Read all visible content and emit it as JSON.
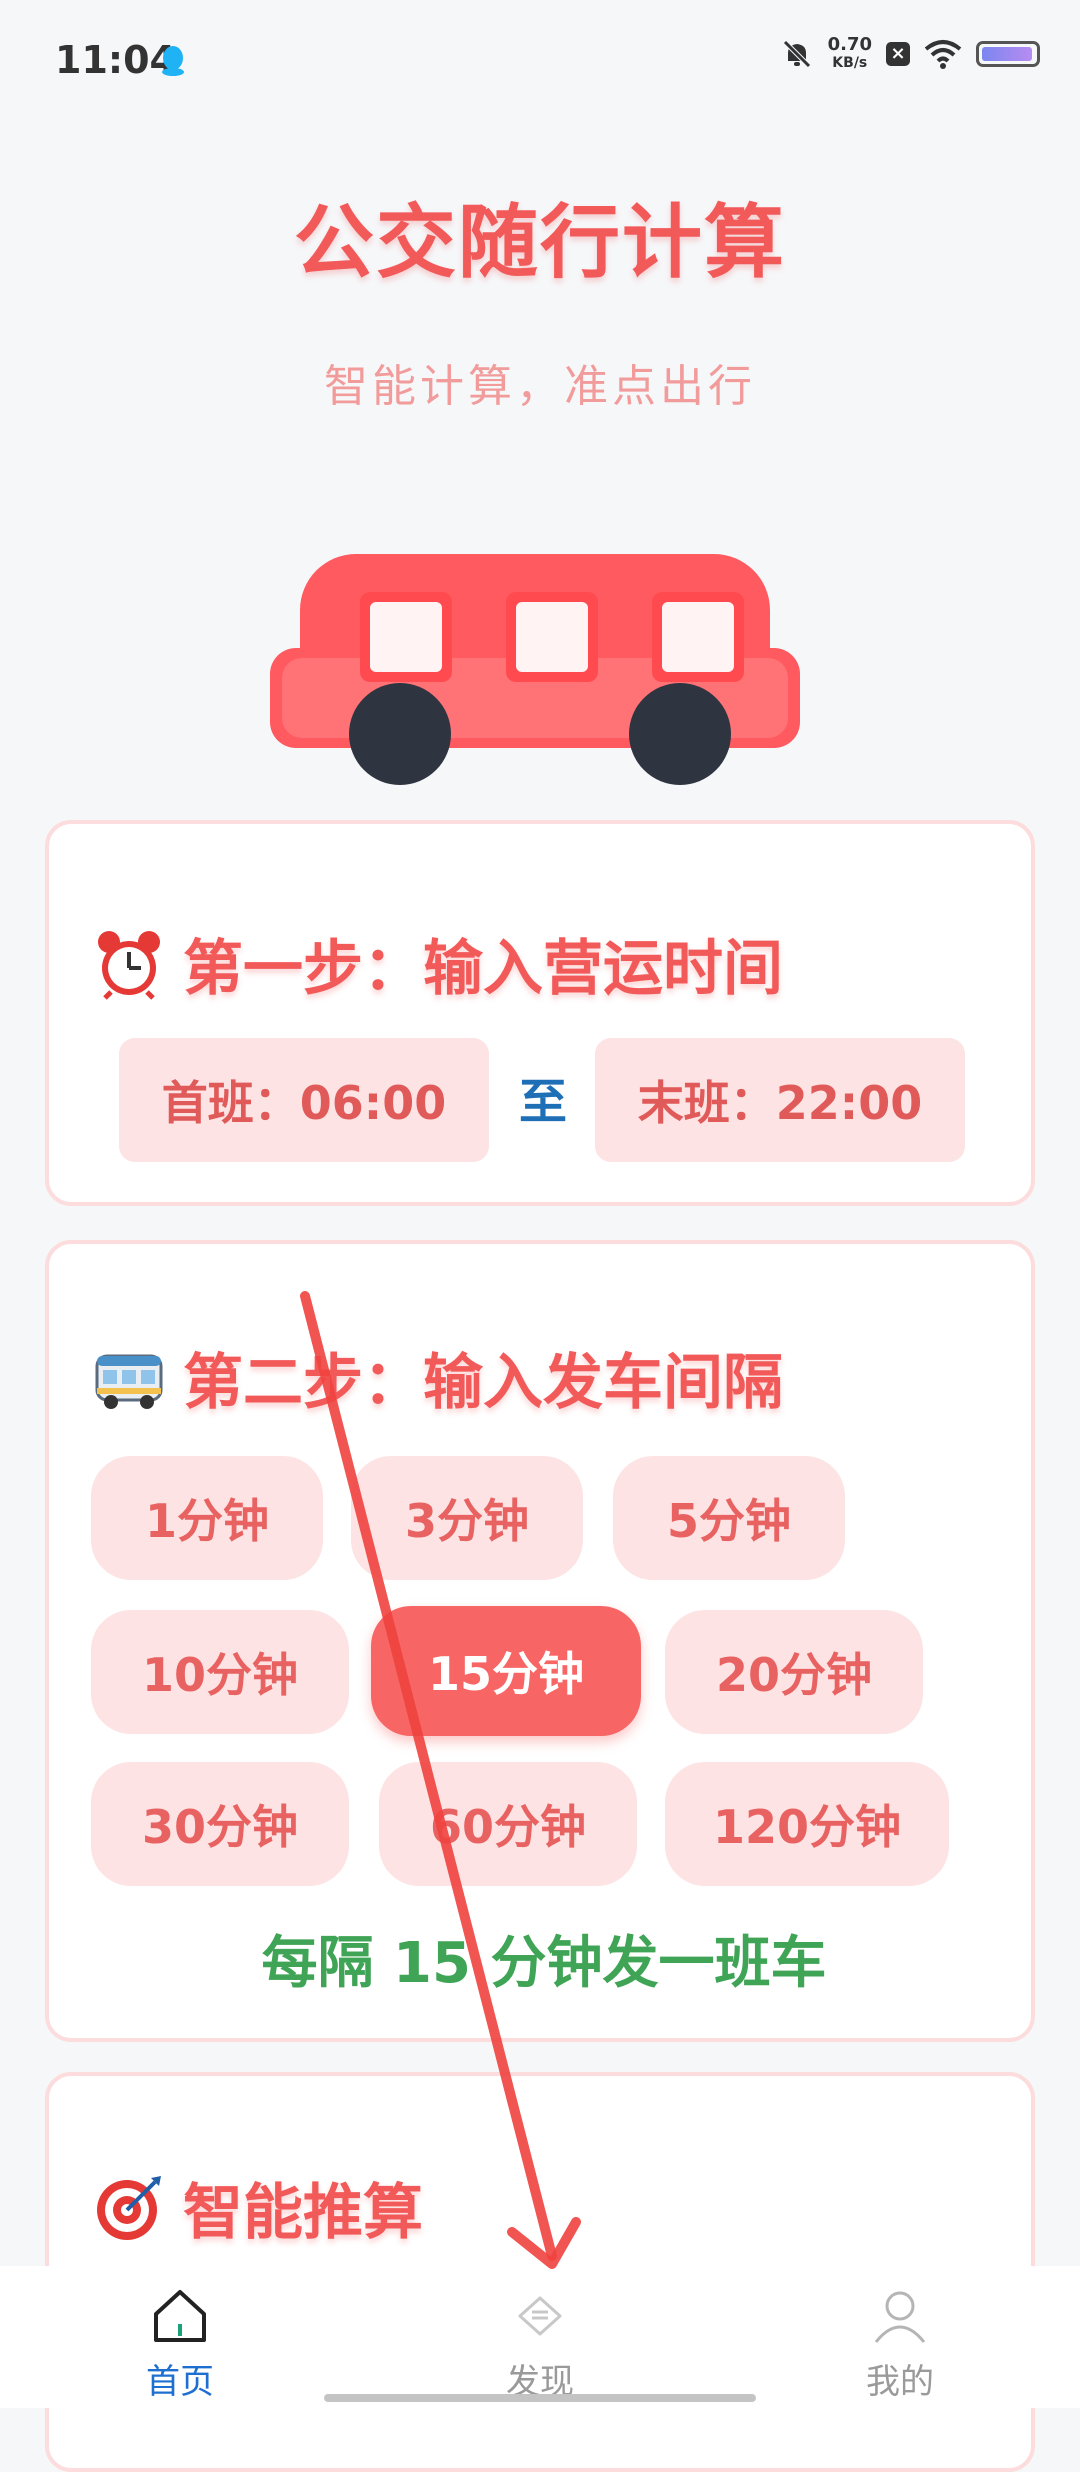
{
  "status_bar": {
    "time": "11:04",
    "net_speed_value": "0.70",
    "net_speed_unit": "KB/s"
  },
  "header": {
    "title": "公交随行计算",
    "subtitle": "智能计算，准点出行"
  },
  "step1": {
    "title": "第一步：输入营运时间",
    "icon": "alarm-clock-icon",
    "first_bus": "首班：06:00",
    "to_label": "至",
    "last_bus": "末班：22:00"
  },
  "step2": {
    "title": "第二步：输入发车间隔",
    "icon": "bus-icon",
    "options": [
      "1分钟",
      "3分钟",
      "5分钟",
      "10分钟",
      "15分钟",
      "20分钟",
      "30分钟",
      "60分钟",
      "120分钟"
    ],
    "selected": "15分钟",
    "summary": "每隔 15 分钟发一班车"
  },
  "step3": {
    "title": "智能推算",
    "icon": "target-icon"
  },
  "bottom_nav": {
    "home": "首页",
    "discover": "发现",
    "me": "我的",
    "active": "home"
  },
  "colors": {
    "accent": "#f25a5a",
    "pill_bg": "#fde3e3",
    "selected": "#f76565",
    "link_blue": "#1f6fd0",
    "note_green": "#3fa455"
  }
}
